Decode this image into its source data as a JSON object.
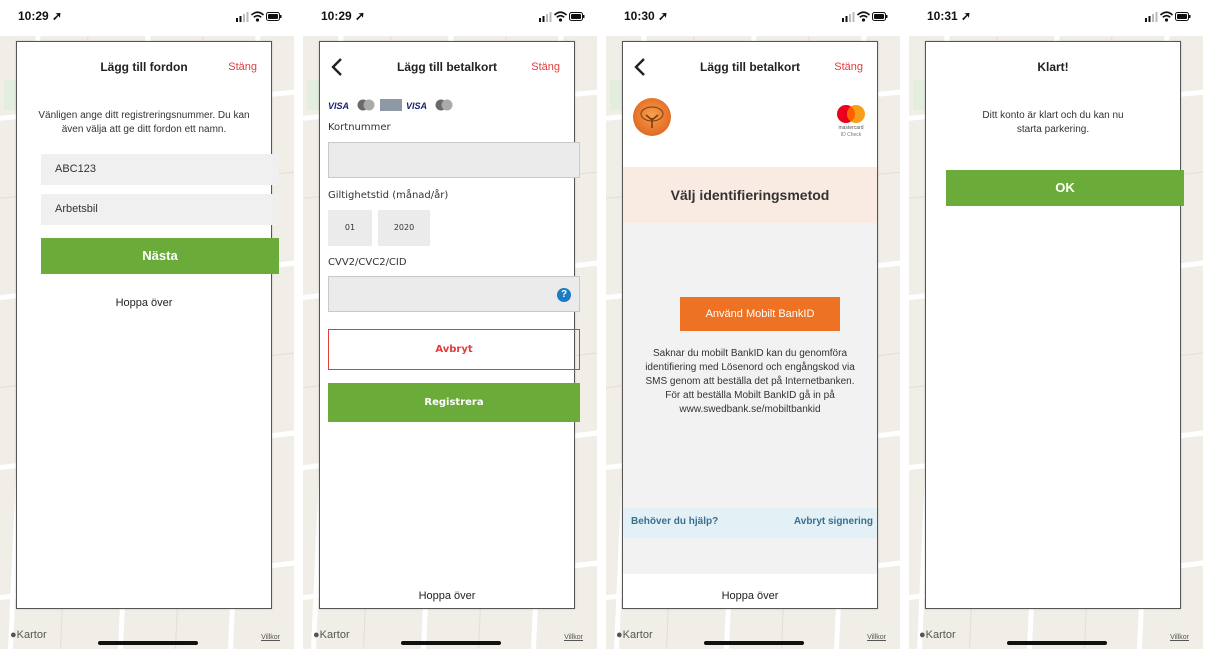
{
  "common": {
    "map_app": "Kartor",
    "terms": "Villkor",
    "skip": "Hoppa över"
  },
  "screen1": {
    "time": "10:29",
    "title": "Lägg till fordon",
    "close": "Stäng",
    "intro": "Vänligen ange ditt registreringsnummer. Du kan även välja att ge ditt fordon ett namn.",
    "reg_value": "ABC123",
    "name_value": "Arbetsbil",
    "next": "Nästa"
  },
  "screen2": {
    "time": "10:29",
    "title": "Lägg till betalkort",
    "close": "Stäng",
    "card_logos": [
      "VISA",
      "mastercard",
      "amex",
      "VISA",
      "mastercard"
    ],
    "card_number_label": "Kortnummer",
    "expiry_label": "Giltighetstid (månad/år)",
    "month": "01",
    "year": "2020",
    "cvv_label": "CVV2/CVC2/CID",
    "cancel": "Avbryt",
    "register": "Registrera"
  },
  "screen3": {
    "time": "10:30",
    "title": "Lägg till betalkort",
    "close": "Stäng",
    "mc_label": "mastercard",
    "mc_sub": "ID Check",
    "heading": "Välj identifieringsmetod",
    "bankid_button": "Använd Mobilt BankID",
    "info": "Saknar du mobilt BankID kan du genomföra identifiering med Lösenord och engångskod via SMS genom att beställa det på Internetbanken. För att beställa Mobilt BankID gå in på www.swedbank.se/mobiltbankid",
    "help": "Behöver du hjälp?",
    "abort": "Avbryt signering"
  },
  "screen4": {
    "time": "10:31",
    "title": "Klart!",
    "message": "Ditt konto är klart och du kan nu starta parkering.",
    "ok": "OK"
  },
  "colors": {
    "green": "#6aab3a",
    "red": "#e23d3d",
    "orange": "#ee7223",
    "blue": "#1a7dc4",
    "map": "#f1eee7"
  },
  "icons": {
    "signal": "signal-icon",
    "wifi": "wifi-icon",
    "battery": "battery-icon",
    "location": "location-arrow-icon",
    "back": "chevron-left-icon",
    "help": "question-icon",
    "apple": "apple-icon"
  }
}
